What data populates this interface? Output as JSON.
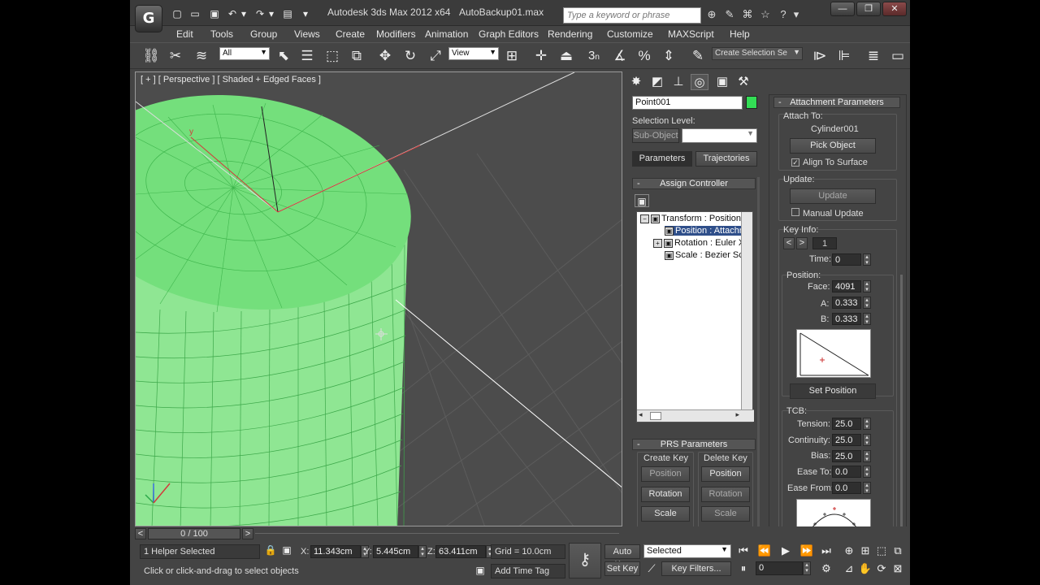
{
  "title": {
    "app": "Autodesk 3ds Max  2012 x64",
    "file": "AutoBackup01.max",
    "search_placeholder": "Type a keyword or phrase",
    "logo": "G"
  },
  "menu": [
    "Edit",
    "Tools",
    "Group",
    "Views",
    "Create",
    "Modifiers",
    "Animation",
    "Graph Editors",
    "Rendering",
    "Customize",
    "MAXScript",
    "Help"
  ],
  "toolbar": {
    "filter": "All",
    "ref_coord": "View",
    "selection_set": "Create Selection Se",
    "snap_3": "3",
    "snap_n": "n"
  },
  "viewport": {
    "label": "[ + ] [ Perspective ] [ Shaded + Edged Faces ]",
    "axis_y": "y",
    "axis_x": "x",
    "axis_z": "z"
  },
  "command_panel": {
    "object_name": "Point001",
    "object_color": "#33dd55",
    "selection_level_label": "Selection Level:",
    "sub_object": "Sub-Object",
    "tab_parameters": "Parameters",
    "tab_trajectories": "Trajectories",
    "assign_controller": {
      "title": "Assign Controller",
      "items": [
        {
          "label": "Transform : Position/",
          "icon": "▣"
        },
        {
          "label": "Position : Attachm",
          "icon": "▣"
        },
        {
          "label": "Rotation : Euler X",
          "icon": "▣"
        },
        {
          "label": "Scale : Bezier Sca",
          "icon": "▣"
        }
      ]
    },
    "prs": {
      "title": "PRS Parameters",
      "create_key": "Create Key",
      "delete_key": "Delete Key",
      "create_buttons": [
        "Position",
        "Rotation",
        "Scale"
      ],
      "delete_buttons": [
        "Position",
        "Rotation",
        "Scale"
      ]
    },
    "attachment": {
      "title": "Attachment Parameters",
      "attach_to_label": "Attach To:",
      "attach_object": "Cylinder001",
      "pick_object": "Pick Object",
      "align_to_surface": "Align To Surface",
      "update_label": "Update:",
      "update_button": "Update",
      "manual_update": "Manual Update",
      "key_info_label": "Key Info:",
      "key_prev": "<",
      "key_next": ">",
      "key_number": "1",
      "time_label": "Time:",
      "time_value": "0",
      "position_label": "Position:",
      "face_label": "Face:",
      "face_value": "4091",
      "a_label": "A:",
      "a_value": "0.333",
      "b_label": "B:",
      "b_value": "0.333",
      "set_position": "Set Position",
      "tcb_label": "TCB:",
      "tension_label": "Tension:",
      "tension_value": "25.0",
      "continuity_label": "Continuity:",
      "continuity_value": "25.0",
      "bias_label": "Bias:",
      "bias_value": "25.0",
      "ease_to_label": "Ease To:",
      "ease_to_value": "0.0",
      "ease_from_label": "Ease From:",
      "ease_from_value": "0.0"
    }
  },
  "timeline": {
    "frame": "0 / 100",
    "prev": "<",
    "next": ">"
  },
  "status": {
    "selection": "1 Helper Selected",
    "prompt": "Click or click-and-drag to select objects",
    "x_label": "X:",
    "x_value": "11.343cm",
    "y_label": "Y:",
    "y_value": "5.445cm",
    "z_label": "Z:",
    "z_value": "63.411cm",
    "grid": "Grid = 10.0cm",
    "add_time_tag": "Add Time Tag",
    "auto_key": "Auto Key",
    "set_key": "Set Key",
    "key_mode": "Selected",
    "key_filters": "Key Filters...",
    "current_frame": "0"
  }
}
